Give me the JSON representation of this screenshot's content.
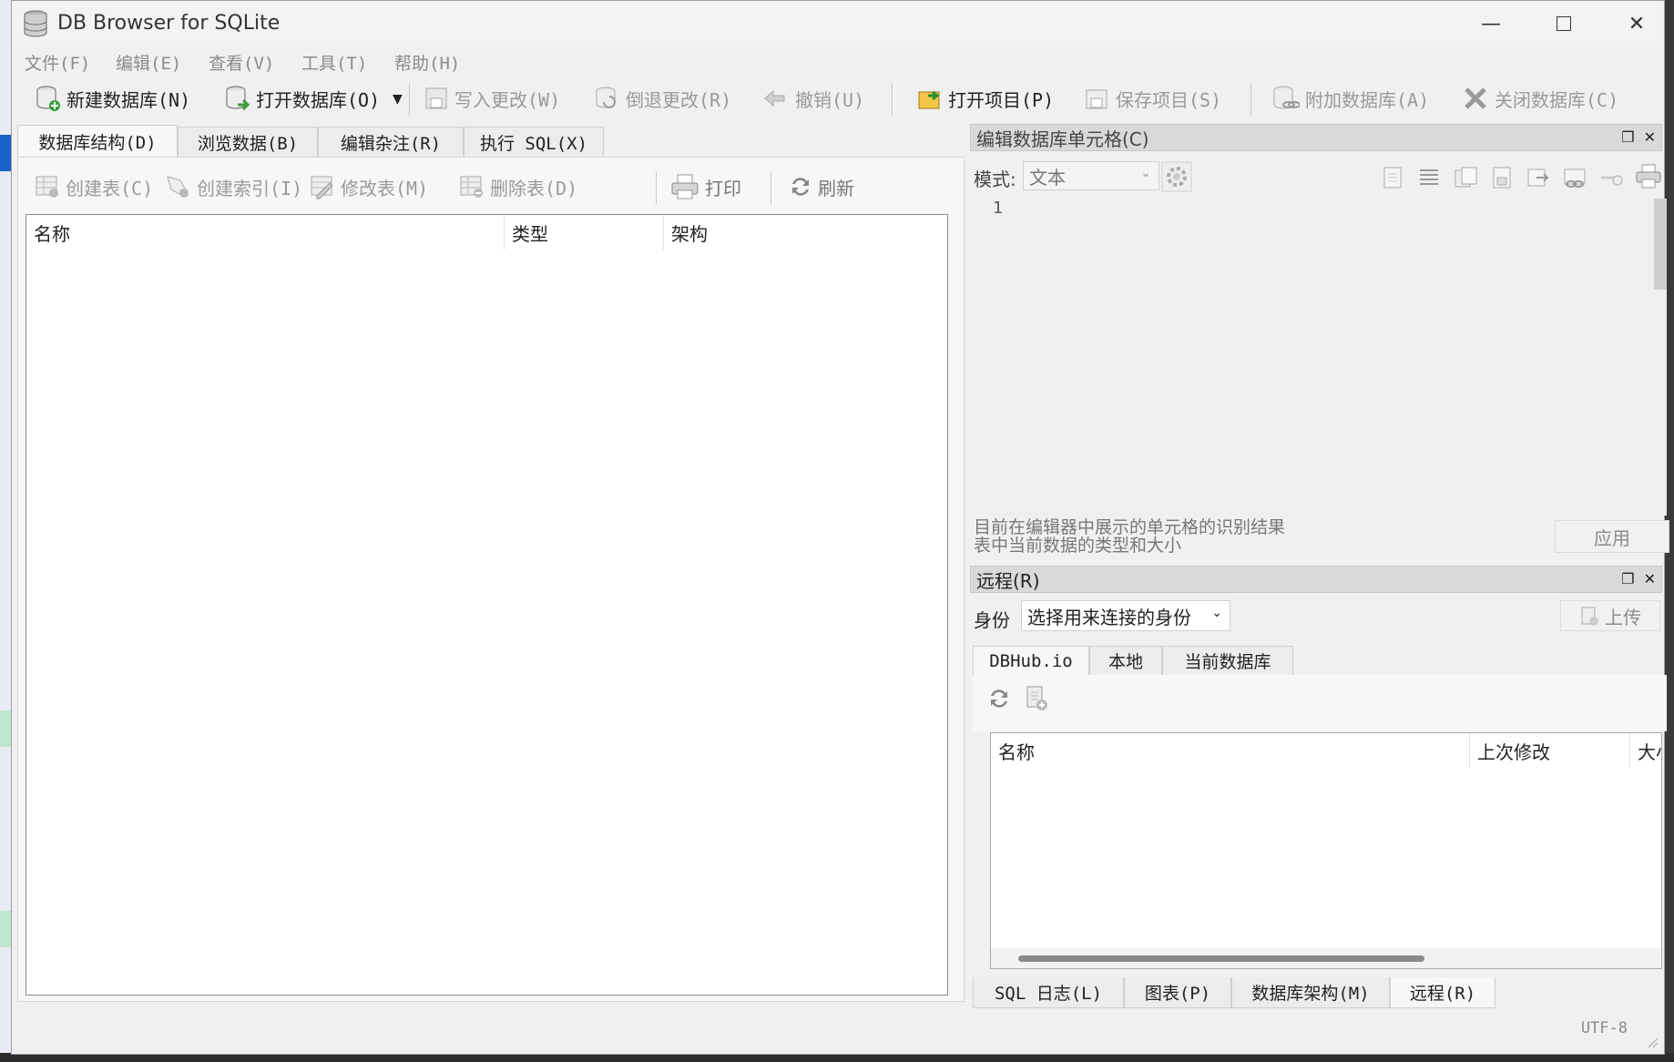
{
  "window": {
    "title": "DB Browser for SQLite"
  },
  "menu": [
    "文件(F)",
    "编辑(E)",
    "查看(V)",
    "工具(T)",
    "帮助(H)"
  ],
  "toolbar": {
    "new_db": "新建数据库(N)",
    "open_db": "打开数据库(O)",
    "write_changes": "写入更改(W)",
    "revert_changes": "倒退更改(R)",
    "undo": "撤销(U)",
    "open_project": "打开项目(P)",
    "save_project": "保存项目(S)",
    "attach_db": "附加数据库(A)",
    "close_db": "关闭数据库(C)"
  },
  "main_tabs": [
    "数据库结构(D)",
    "浏览数据(B)",
    "编辑杂注(R)",
    "执行 SQL(X)"
  ],
  "structure_toolbar": {
    "create_table": "创建表(C)",
    "create_index": "创建索引(I)",
    "modify_table": "修改表(M)",
    "delete_table": "删除表(D)",
    "print": "打印",
    "refresh": "刷新"
  },
  "tree_columns": [
    "名称",
    "类型",
    "架构"
  ],
  "edit_cell": {
    "title": "编辑数据库单元格(C)",
    "mode_label": "模式:",
    "mode_value": "文本",
    "line_number": "1",
    "info_line1": "目前在编辑器中展示的单元格的识别结果",
    "info_line2": "表中当前数据的类型和大小",
    "apply": "应用"
  },
  "remote": {
    "title": "远程(R)",
    "identity_label": "身份",
    "identity_value": "选择用来连接的身份",
    "upload": "上传",
    "tabs": [
      "DBHub.io",
      "本地",
      "当前数据库"
    ],
    "columns": [
      "名称",
      "上次修改",
      "大小"
    ]
  },
  "bottom_tabs": [
    "SQL 日志(L)",
    "图表(P)",
    "数据库架构(M)",
    "远程(R)"
  ],
  "status": {
    "encoding": "UTF-8"
  }
}
